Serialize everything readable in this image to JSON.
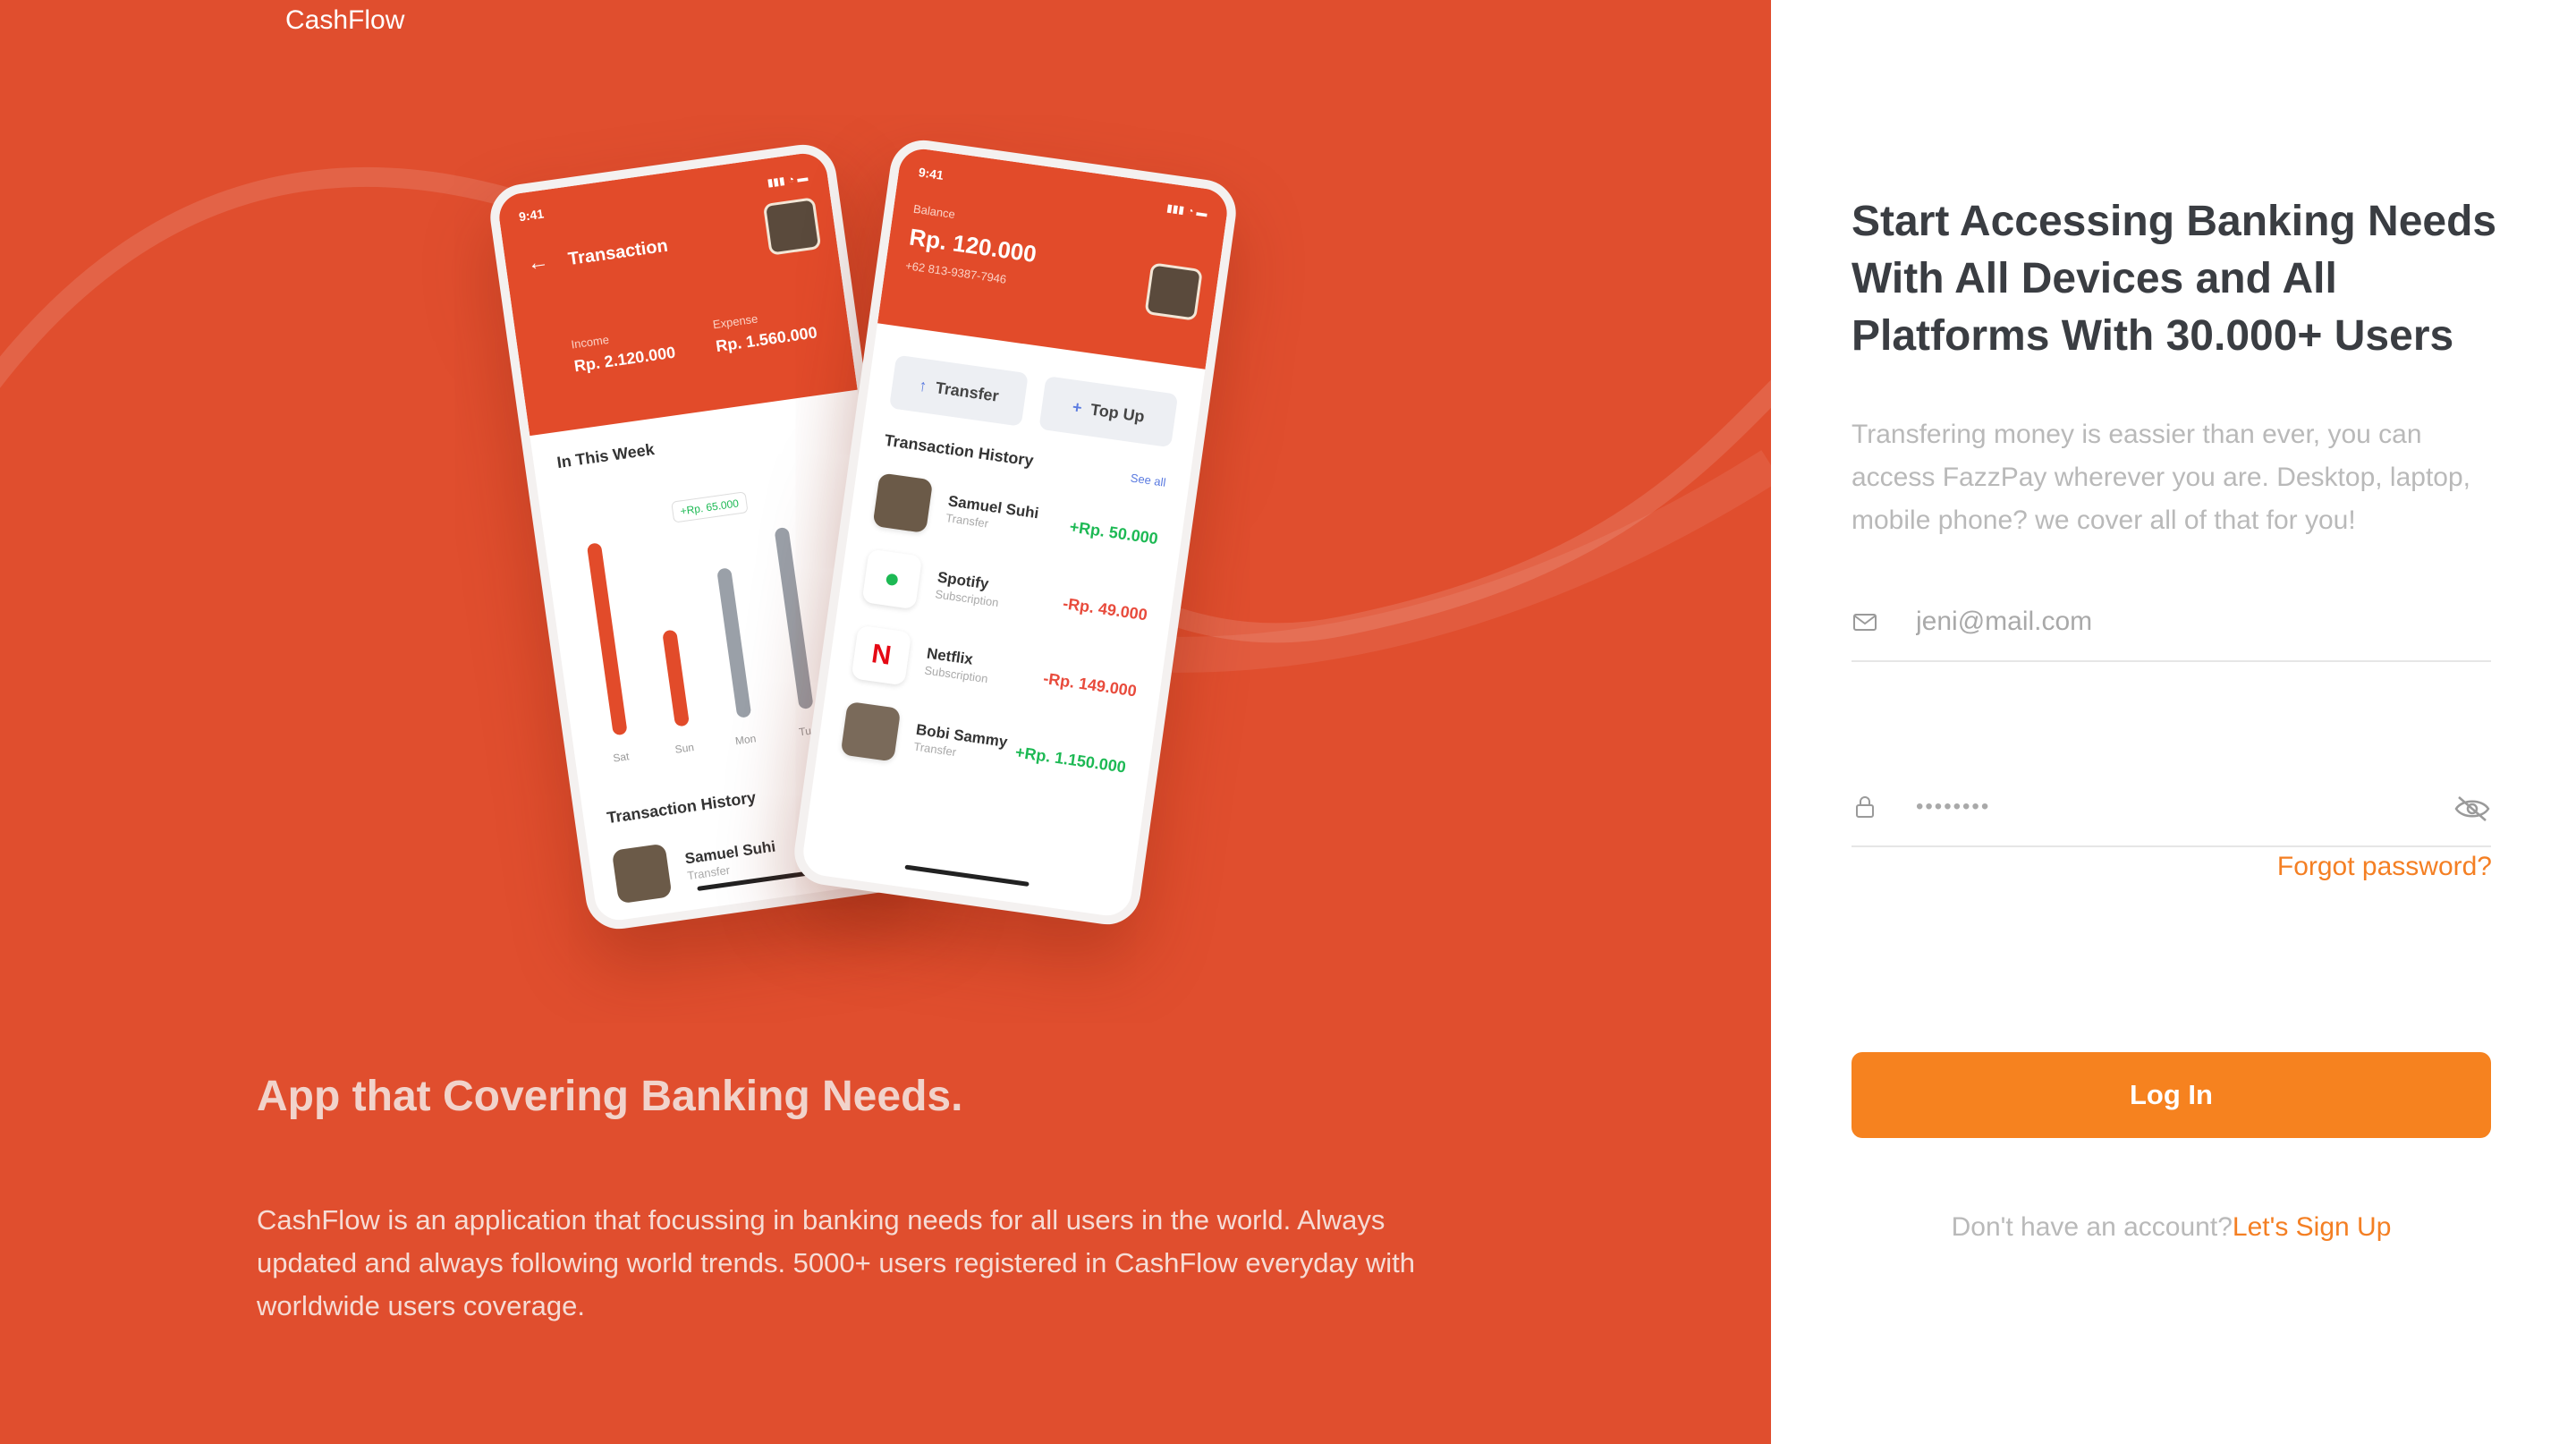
{
  "brand": {
    "name": "CashFlow"
  },
  "hero": {
    "title": "App that Covering Banking Needs.",
    "description": "CashFlow is an application that focussing in banking needs for all users in the world. Always updated and always following world trends. 5000+ users registered in CashFlow everyday with worldwide users coverage."
  },
  "phone_left": {
    "time": "9:41",
    "title": "Transaction",
    "income_label": "Income",
    "income_value": "Rp. 2.120.000",
    "expense_label": "Expense",
    "expense_value": "Rp. 1.560.000",
    "week_title": "In This Week",
    "tag": "+Rp. 65.000",
    "days": [
      "Sat",
      "Sun",
      "Mon",
      "Tue"
    ],
    "bar_levels": [
      0.9,
      0.45,
      0.7,
      0.85
    ],
    "history_title": "Transaction History",
    "history_name": "Samuel Suhi",
    "history_type": "Transfer"
  },
  "phone_right": {
    "time": "9:41",
    "balance_label": "Balance",
    "balance_value": "Rp. 120.000",
    "phone_number": "+62 813-9387-7946",
    "transfer_label": "Transfer",
    "topup_label": "Top Up",
    "history_title": "Transaction History",
    "see_all": "See all",
    "transactions": [
      {
        "name": "Samuel Suhi",
        "type": "Transfer",
        "amount": "+Rp. 50.000",
        "positive": true
      },
      {
        "name": "Spotify",
        "type": "Subscription",
        "amount": "-Rp. 49.000",
        "positive": false
      },
      {
        "name": "Netflix",
        "type": "Subscription",
        "amount": "-Rp. 149.000",
        "positive": false
      },
      {
        "name": "Bobi Sammy",
        "type": "Transfer",
        "amount": "+Rp. 1.150.000",
        "positive": true
      }
    ]
  },
  "login": {
    "title": "Start Accessing Banking Needs With All Devices and All Platforms With 30.000+ Users",
    "description": "Transfering money is eassier than ever, you can access FazzPay wherever you are. Desktop, laptop, mobile phone? we cover all of that for you!",
    "email_placeholder": "jeni@mail.com",
    "password_value": "••••••••",
    "forgot_label": "Forgot password?",
    "login_label": "Log In",
    "signup_prompt": "Don't have an account?",
    "signup_link": "Let's Sign Up"
  },
  "colors": {
    "brand_red": "#E04E2E",
    "accent_orange": "#F6821F",
    "text_dark": "#3A3D42",
    "text_muted": "#B9B9B9"
  }
}
